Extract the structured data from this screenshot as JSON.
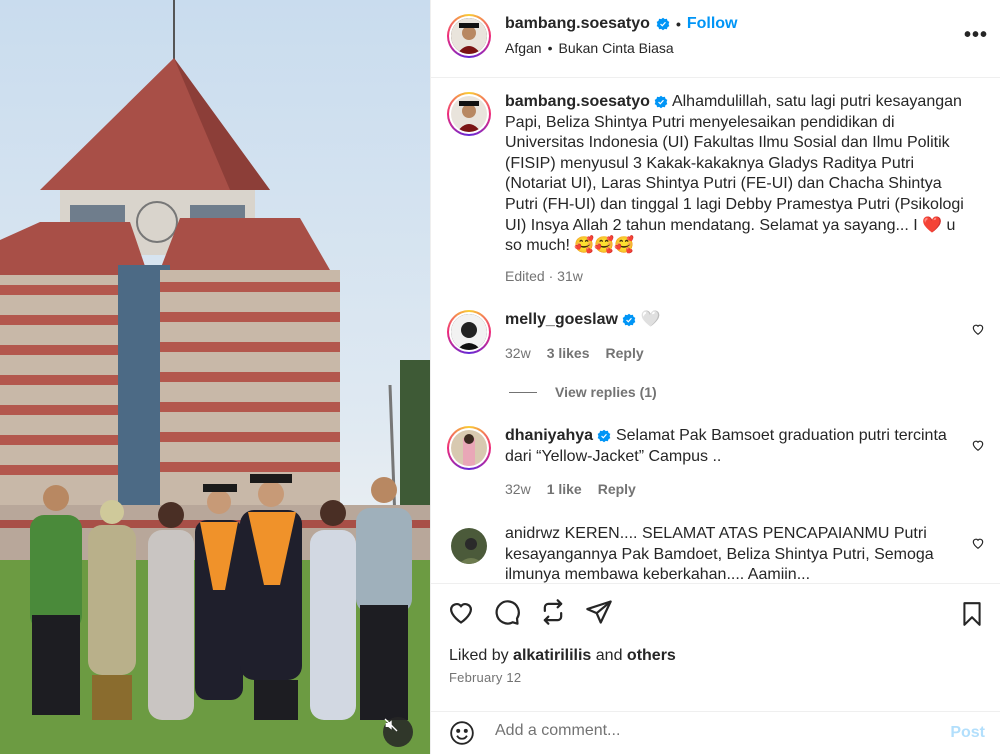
{
  "post_header": {
    "username": "bambang.soesatyo",
    "separator": "•",
    "follow_label": "Follow",
    "music_artist": "Afgan",
    "music_separator": "•",
    "music_title": "Bukan Cinta Biasa",
    "more_icon": "more-horizontal-icon",
    "more_label": "•••"
  },
  "caption": {
    "username": "bambang.soesatyo",
    "text": "Alhamdulillah, satu lagi putri kesayangan Papi, Beliza Shintya Putri menyelesaikan pendidikan di Universitas Indonesia (UI) Fakultas Ilmu Sosial dan Ilmu Politik (FISIP) menyusul 3 Kakak-kakaknya Gladys Raditya Putri (Notariat UI), Laras Shintya Putri (FE-UI) dan Chacha Shintya Putri (FH-UI) dan tinggal 1 lagi Debby Pramestya Putri (Psikologi UI) Insya Allah 2 tahun mendatang. Selamat ya sayang... I ❤️ u so much! 🥰🥰🥰",
    "edited": "Edited",
    "time": "31w"
  },
  "comments": [
    {
      "username": "melly_goeslaw",
      "text": "🤍",
      "verified": true,
      "time": "32w",
      "likes": "3 likes",
      "reply": "Reply"
    },
    {
      "username": "dhaniyahya",
      "text": "Selamat Pak Bamsoet graduation putri tercinta dari “Yellow-Jacket” Campus ..",
      "verified": true,
      "time": "32w",
      "likes": "1 like",
      "reply": "Reply"
    },
    {
      "username": "anidrwz",
      "text": "KEREN.... SELAMAT ATAS PENCAPAIANMU Putri kesayangannya Pak Bamdoet, Beliza Shintya Putri, Semoga ilmunya membawa keberkahan.... Aamiin...",
      "verified": false
    }
  ],
  "view_replies": "View replies (1)",
  "action_icons": [
    "heart-icon",
    "comment-icon",
    "share-icon",
    "send-icon",
    "bookmark-icon"
  ],
  "likes": {
    "prefix": "Liked by",
    "user": "alkatirililis",
    "conj": "and",
    "others": "others"
  },
  "date": "February 12",
  "comment_box": {
    "placeholder": "Add a comment...",
    "post_label": "Post"
  },
  "colors": {
    "link": "#0095f6",
    "verified": "#0095f6",
    "muted": "#737373",
    "post_disabled": "#b2dffc"
  }
}
